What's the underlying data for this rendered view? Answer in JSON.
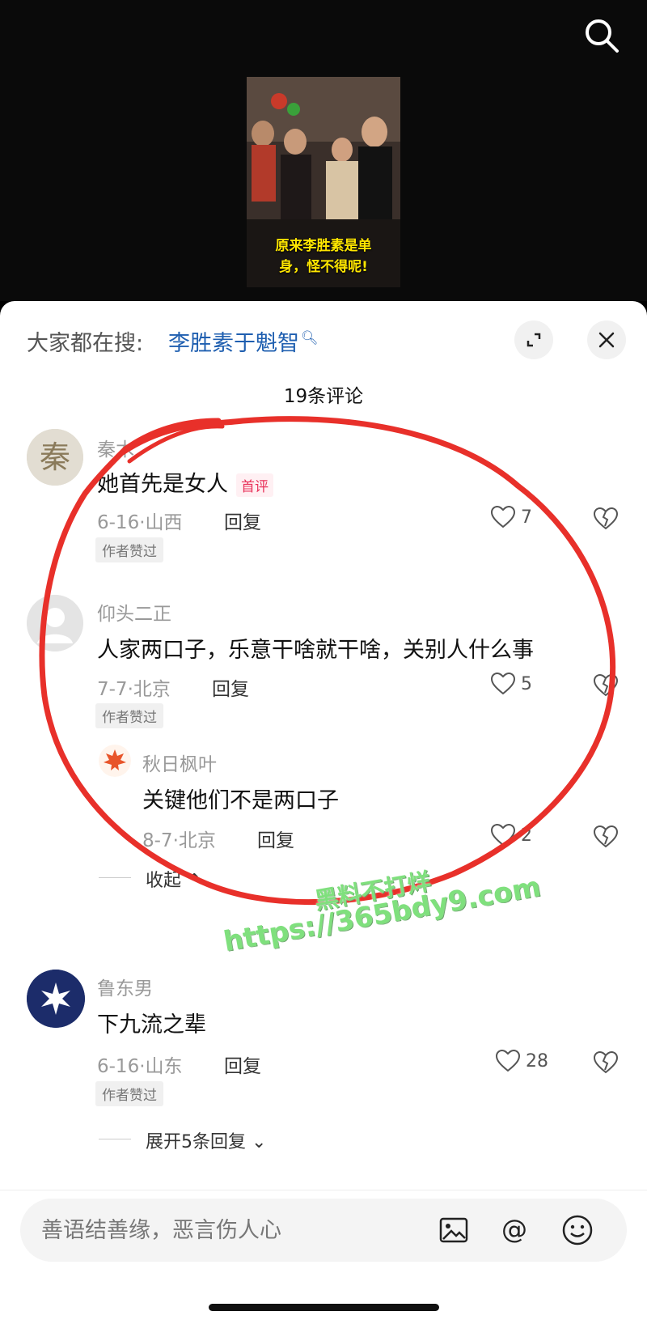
{
  "video": {
    "caption_line1": "原来李胜素是单",
    "caption_line2": "身，怪不得呢!"
  },
  "sheet": {
    "hot_prefix": "大家都在搜:",
    "hot_term": "李胜素于魁智",
    "count": "19条评论"
  },
  "comments": [
    {
      "user": "秦木",
      "text": "她首先是女人",
      "tag": "首评",
      "date": "6-16·山西",
      "reply": "回复",
      "likes": "7",
      "badge": "作者赞过"
    },
    {
      "user": "仰头二正",
      "text": "人家两口子，乐意干啥就干啥，关别人什么事",
      "date": "7-7·北京",
      "reply": "回复",
      "likes": "5",
      "badge": "作者赞过",
      "sub_reply": {
        "user": "秋日枫叶",
        "text": "关键他们不是两口子",
        "date": "8-7·北京",
        "reply": "回复",
        "likes": "2"
      },
      "collapse": "收起"
    },
    {
      "user": "鲁东男",
      "text": "下九流之辈",
      "date": "6-16·山东",
      "reply": "回复",
      "likes": "28",
      "badge": "作者赞过",
      "expand": "展开5条回复"
    }
  ],
  "composer": {
    "placeholder": "善语结善缘，恶言伤人心"
  },
  "watermark": {
    "line1": "黑料不打烊",
    "line2": "https://365bdy9.com"
  },
  "colors": {
    "link": "#1f5fb0",
    "caption": "#ffe600",
    "annotation": "#e8302a",
    "watermark": "#7fe07d"
  }
}
